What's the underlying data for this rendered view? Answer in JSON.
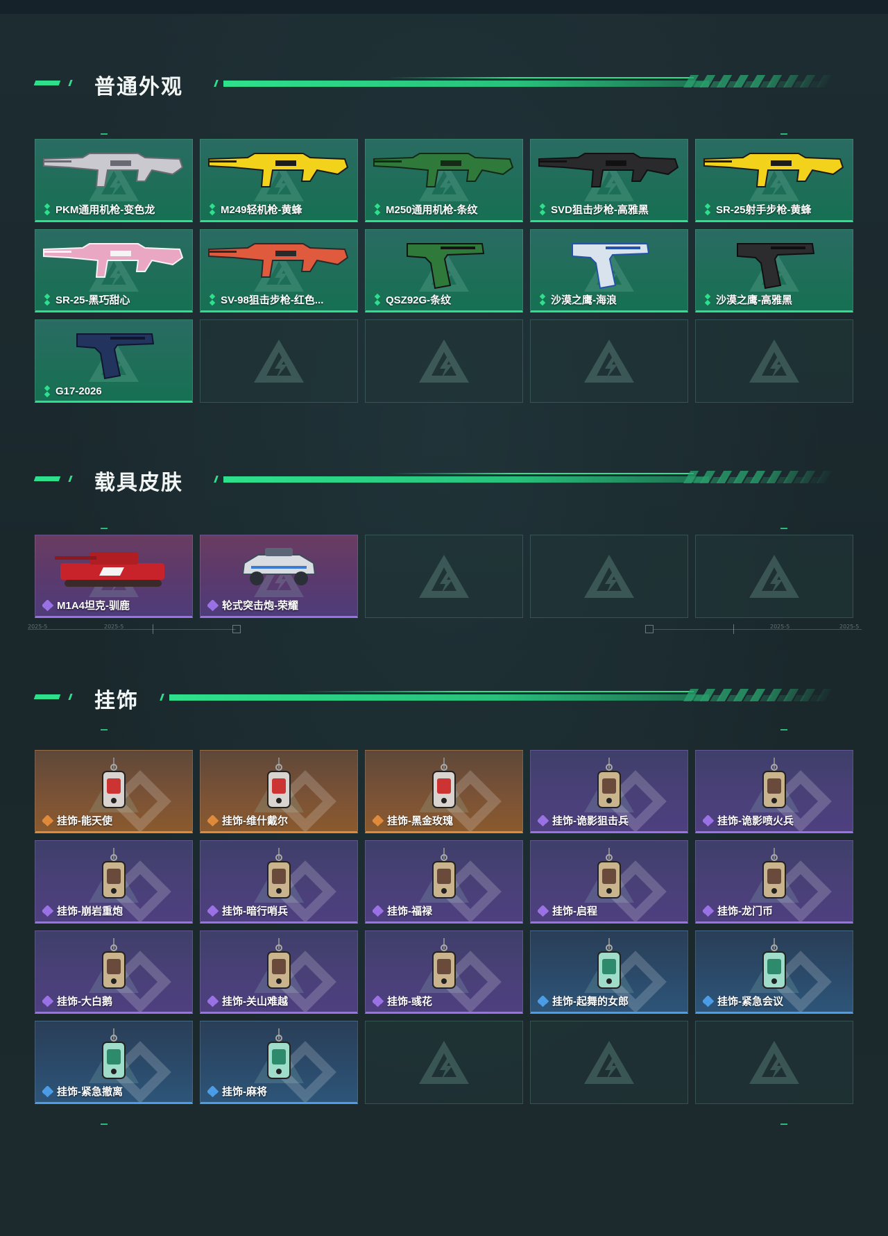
{
  "sections": [
    {
      "title": "普通外观",
      "items": [
        {
          "label": "PKM通用机枪-变色龙",
          "rarity": "green"
        },
        {
          "label": "M249轻机枪-黄蜂",
          "rarity": "green"
        },
        {
          "label": "M250通用机枪-条纹",
          "rarity": "green"
        },
        {
          "label": "SVD狙击步枪-高雅黑",
          "rarity": "green"
        },
        {
          "label": "SR-25射手步枪-黄蜂",
          "rarity": "green"
        },
        {
          "label": "SR-25-黑巧甜心",
          "rarity": "green"
        },
        {
          "label": "SV-98狙击步枪-红色...",
          "rarity": "green"
        },
        {
          "label": "QSZ92G-条纹",
          "rarity": "green"
        },
        {
          "label": "沙漠之鹰-海浪",
          "rarity": "green"
        },
        {
          "label": "沙漠之鹰-高雅黑",
          "rarity": "green"
        },
        {
          "label": "G17-2026",
          "rarity": "green"
        }
      ]
    },
    {
      "title": "载具皮肤",
      "items": [
        {
          "label": "M1A4坦克-驯鹿",
          "rarity": "purple"
        },
        {
          "label": "轮式突击炮-荣耀",
          "rarity": "purple"
        }
      ]
    },
    {
      "title": "挂饰",
      "items": [
        {
          "label": "挂饰-能天使",
          "rarity": "orange"
        },
        {
          "label": "挂饰-维什戴尔",
          "rarity": "orange"
        },
        {
          "label": "挂饰-黑金玫瑰",
          "rarity": "orange"
        },
        {
          "label": "挂饰-诡影狙击兵",
          "rarity": "violet"
        },
        {
          "label": "挂饰-诡影喷火兵",
          "rarity": "violet"
        },
        {
          "label": "挂饰-崩岩重炮",
          "rarity": "violet"
        },
        {
          "label": "挂饰-暗行哨兵",
          "rarity": "violet"
        },
        {
          "label": "挂饰-福禄",
          "rarity": "violet"
        },
        {
          "label": "挂饰-启程",
          "rarity": "violet"
        },
        {
          "label": "挂饰-龙门币",
          "rarity": "violet"
        },
        {
          "label": "挂饰-大白鹅",
          "rarity": "violet"
        },
        {
          "label": "挂饰-关山难越",
          "rarity": "violet"
        },
        {
          "label": "挂饰-彧花",
          "rarity": "violet"
        },
        {
          "label": "挂饰-起舞的女郎",
          "rarity": "blue"
        },
        {
          "label": "挂饰-紧急会议",
          "rarity": "blue"
        },
        {
          "label": "挂饰-紧急撤离",
          "rarity": "blue"
        },
        {
          "label": "挂饰-麻将",
          "rarity": "blue"
        }
      ]
    }
  ],
  "colors": {
    "accent": "#2ee08c",
    "rarity_green": "#2ee08c",
    "rarity_purple": "#9a72e6",
    "rarity_orange": "#e08a3c",
    "rarity_blue": "#4a9de6"
  },
  "timeline_labels": [
    "2025-5",
    "2025-5",
    "2025-5",
    "2025-5"
  ]
}
